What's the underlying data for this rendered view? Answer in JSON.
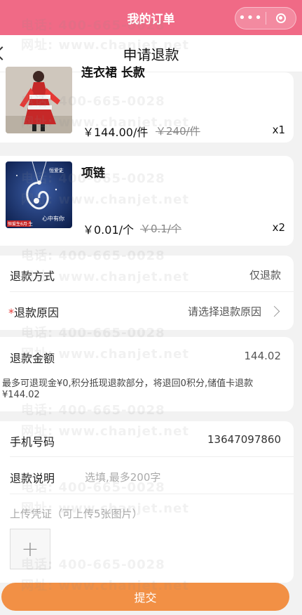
{
  "mp_bar": {
    "title": "我的订单",
    "more_label": "•••"
  },
  "header": {
    "title": "申请退款"
  },
  "products": [
    {
      "name": "连衣裙 长款",
      "price": "￥144.00/件",
      "original_price": "￥240/件",
      "qty": "x1"
    },
    {
      "name": "项链",
      "price": "￥0.01/个",
      "original_price": "￥0.1/个",
      "qty": "x2",
      "img_brand": "恒爱生",
      "img_slogan": "心中有你",
      "img_tag": "恒爱生6月·生"
    }
  ],
  "refund_method": {
    "label": "退款方式",
    "value": "仅退款"
  },
  "refund_reason": {
    "required_mark": "*",
    "label": "退款原因",
    "placeholder": "请选择退款原因"
  },
  "refund_amount": {
    "label": "退款金额",
    "value": "144.02"
  },
  "refund_note": "最多可退现金¥0,积分抵现退款部分，将退回0积分,储值卡退款¥144.02",
  "phone": {
    "label": "手机号码",
    "value": "13647097860"
  },
  "explain": {
    "label": "退款说明",
    "placeholder": "选填,最多200字"
  },
  "upload": {
    "label": "上传凭证（可上传5张图片）",
    "plus": "+"
  },
  "submit_label": "提交",
  "watermark": {
    "phone": "电话: 400-665-0028",
    "site": "网址: www.chanjet.net"
  },
  "colors": {
    "topbar": "#f06a86",
    "submit": "#f29045",
    "required": "#e53935"
  }
}
